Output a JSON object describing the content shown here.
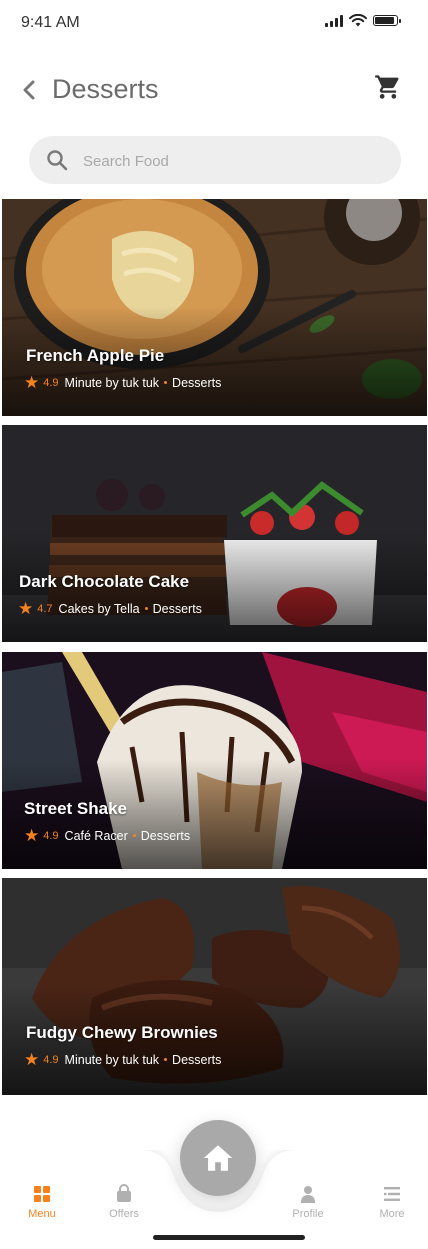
{
  "status_bar": {
    "time": "9:41 AM"
  },
  "header": {
    "title": "Desserts"
  },
  "search": {
    "placeholder": "Search Food"
  },
  "items": [
    {
      "name": "French Apple Pie",
      "rating": "4.9",
      "restaurant": "Minute by tuk tuk",
      "category": "Desserts"
    },
    {
      "name": "Dark Chocolate Cake",
      "rating": "4.7",
      "restaurant": "Cakes by Tella",
      "category": "Desserts"
    },
    {
      "name": "Street Shake",
      "rating": "4.9",
      "restaurant": "Café Racer",
      "category": "Desserts"
    },
    {
      "name": "Fudgy Chewy Brownies",
      "rating": "4.9",
      "restaurant": "Minute by tuk tuk",
      "category": "Desserts"
    }
  ],
  "bottom_nav": {
    "items": [
      {
        "label": "Menu",
        "icon": "grid-icon",
        "active": true
      },
      {
        "label": "Offers",
        "icon": "bag-icon",
        "active": false
      },
      {
        "label": "Profile",
        "icon": "user-icon",
        "active": false
      },
      {
        "label": "More",
        "icon": "list-icon",
        "active": false
      }
    ],
    "home_icon": "home-icon"
  },
  "colors": {
    "accent": "#f5821f",
    "inactive": "#b0b0b0",
    "home_button": "#a9a9a9",
    "search_bg": "#eeeeee"
  }
}
